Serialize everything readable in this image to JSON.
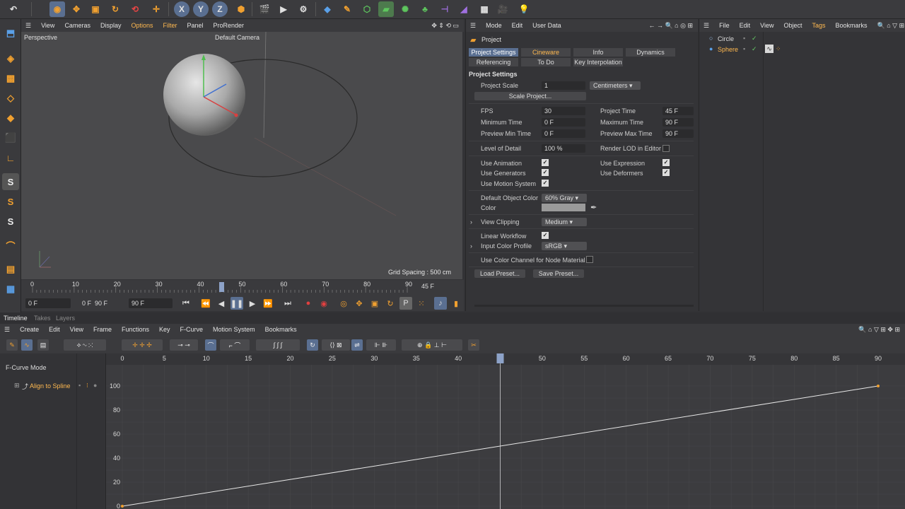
{
  "toolbar": {
    "icons": [
      "undo-icon",
      "move-icon",
      "scale-icon",
      "rotate-icon",
      "recent-icon",
      "x-axis",
      "y-axis",
      "z-axis",
      "coord-icon",
      "render-view-icon",
      "render-icon",
      "render-settings-icon",
      "cube-icon",
      "pen-icon",
      "subdivision-icon",
      "extrude-icon",
      "array-icon",
      "cloner-icon",
      "deformer-icon",
      "spline-icon",
      "floor-icon",
      "camera-icon",
      "light-icon"
    ],
    "axis_x": "X",
    "axis_y": "Y",
    "axis_z": "Z"
  },
  "viewport": {
    "menu": [
      "View",
      "Cameras",
      "Display",
      "Options",
      "Filter",
      "Panel",
      "ProRender"
    ],
    "label": "Perspective",
    "camera": "Default Camera",
    "grid_spacing": "Grid Spacing : 500 cm"
  },
  "ruler": {
    "ticks": [
      "0",
      "10",
      "20",
      "30",
      "40",
      "50",
      "60",
      "70",
      "80",
      "90"
    ],
    "current": "45 F"
  },
  "transport": {
    "start": "0 F",
    "min": "0 F",
    "max": "90 F",
    "end": "90 F"
  },
  "attributes": {
    "menu": [
      "Mode",
      "Edit",
      "User Data"
    ],
    "object": "Project",
    "tabs": [
      "Project Settings",
      "Cineware",
      "Info",
      "Dynamics",
      "Referencing",
      "To Do",
      "Key Interpolation"
    ],
    "section": "Project Settings",
    "project_scale_label": "Project Scale",
    "project_scale": "1",
    "project_scale_unit": "Centimeters",
    "scale_project_btn": "Scale Project...",
    "fps_label": "FPS",
    "fps": "30",
    "project_time_label": "Project Time",
    "project_time": "45 F",
    "min_time_label": "Minimum Time",
    "min_time": "0 F",
    "max_time_label": "Maximum Time",
    "max_time": "90 F",
    "prev_min_label": "Preview Min Time",
    "prev_min": "0 F",
    "prev_max_label": "Preview Max Time",
    "prev_max": "90 F",
    "lod_label": "Level of Detail",
    "lod": "100 %",
    "render_lod_label": "Render LOD in Editor",
    "use_animation": "Use Animation",
    "use_expression": "Use Expression",
    "use_generators": "Use Generators",
    "use_deformers": "Use Deformers",
    "use_motion": "Use Motion System",
    "default_color_label": "Default Object Color",
    "default_color": "60% Gray",
    "color_label": "Color",
    "view_clipping_label": "View Clipping",
    "view_clipping": "Medium",
    "linear_workflow": "Linear Workflow",
    "input_profile_label": "Input Color Profile",
    "input_profile": "sRGB",
    "node_material": "Use Color Channel for Node Material",
    "load_preset": "Load Preset...",
    "save_preset": "Save Preset..."
  },
  "objects": {
    "menu": [
      "File",
      "Edit",
      "View",
      "Object",
      "Tags",
      "Bookmarks"
    ],
    "items": [
      {
        "name": "Circle"
      },
      {
        "name": "Sphere"
      }
    ]
  },
  "timeline": {
    "tabs": [
      "Timeline",
      "Takes",
      "Layers"
    ],
    "menu": [
      "Create",
      "Edit",
      "View",
      "Frame",
      "Functions",
      "Key",
      "F-Curve",
      "Motion System",
      "Bookmarks"
    ],
    "mode": "F-Curve Mode",
    "track": "Align to Spline",
    "x_ticks": [
      "0",
      "5",
      "10",
      "15",
      "20",
      "25",
      "30",
      "35",
      "40",
      "45",
      "50",
      "55",
      "60",
      "65",
      "70",
      "75",
      "80",
      "85",
      "90"
    ],
    "y_ticks": [
      "100",
      "80",
      "60",
      "40",
      "20",
      "0"
    ]
  },
  "chart_data": {
    "type": "line",
    "x": [
      0,
      90
    ],
    "y": [
      0,
      100
    ],
    "xlim": [
      0,
      90
    ],
    "ylim": [
      0,
      100
    ]
  }
}
